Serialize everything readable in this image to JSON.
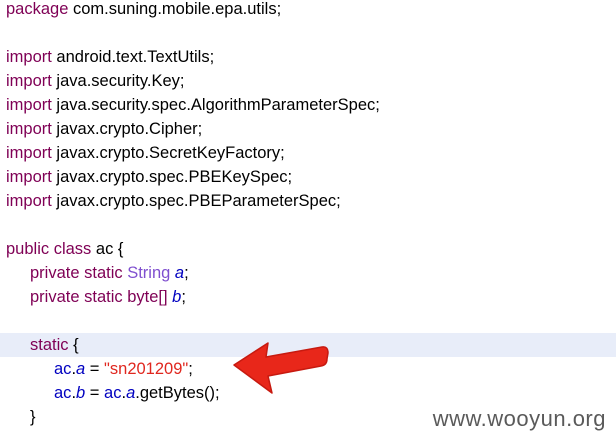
{
  "code": {
    "package_kw": "package",
    "package_name": " com.suning.mobile.epa.utils;",
    "import_kw": "import",
    "imports": [
      " android.text.TextUtils;",
      " java.security.Key;",
      " java.security.spec.AlgorithmParameterSpec;",
      " javax.crypto.Cipher;",
      " javax.crypto.SecretKeyFactory;",
      " javax.crypto.spec.PBEKeySpec;",
      " javax.crypto.spec.PBEParameterSpec;"
    ],
    "class_decl": {
      "public_kw": "public",
      "class_kw": " class",
      "name": " ac",
      "brace": " {"
    },
    "field1": {
      "mods": "private static",
      "type": " String",
      "name": " a",
      "end": ";"
    },
    "field2": {
      "mods": "private static",
      "type": " byte[]",
      "name": " b",
      "end": ";"
    },
    "static_block": {
      "kw": "static",
      "brace": " {"
    },
    "assign1": {
      "cls": "ac",
      "dot": ".",
      "field": "a",
      "op": " = ",
      "value": "\"sn201209\"",
      "end": ";"
    },
    "assign2": {
      "cls": "ac",
      "dot": ".",
      "field": "b",
      "op": " = ",
      "cls2": "ac",
      "dot2": ".",
      "field2": "a",
      "call": ".getBytes();"
    },
    "close_brace": "}"
  },
  "annotation": {
    "arrow_color": "#e8271a",
    "arrow_icon": "left-pointing-arrow"
  },
  "watermark": "www.wooyun.org",
  "colors": {
    "current_line": "#e8edf9",
    "keyword": "#7f0055",
    "field": "#0000c0",
    "type": "#7f4fcf",
    "string": "#e0271f"
  }
}
